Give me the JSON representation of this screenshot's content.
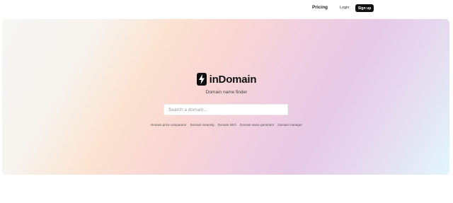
{
  "nav": {
    "pricing": "Pricing",
    "login": "Login",
    "signup": "Sign up"
  },
  "brand": {
    "name": "inDomain",
    "icon": "lightning-bolt-icon"
  },
  "tagline": "Domain name finder",
  "search": {
    "placeholder": "Search a domain...",
    "value": ""
  },
  "links": [
    "Domain price comparator",
    "Domain meaning",
    "Domain SEO",
    "Domain name generator",
    "Domain manager"
  ]
}
